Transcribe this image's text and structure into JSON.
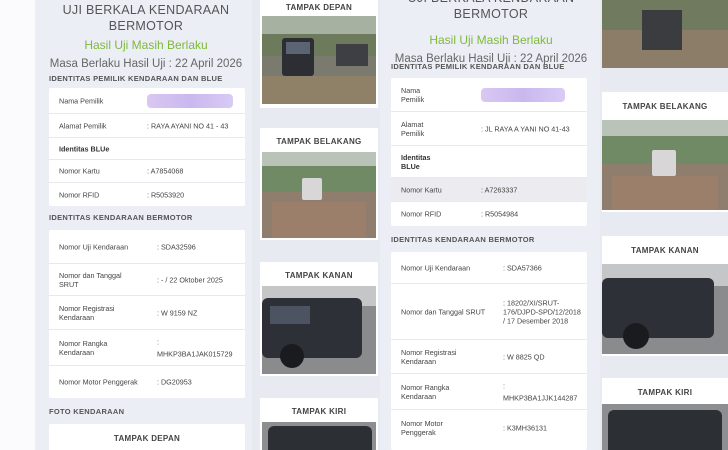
{
  "left": {
    "title_line1": "UJI BERKALA KENDARAAN",
    "title_line2": "BERMOTOR",
    "status": "Hasil Uji Masih Berlaku",
    "validity": "Masa Berlaku Hasil Uji : 22 April 2026",
    "owner_section": "IDENTITAS PEMILIK KENDARAAN DAN BLUe",
    "owner_rows": [
      {
        "label": "Nama Pemilik",
        "value": ""
      },
      {
        "label": "Alamat Pemilik",
        "value": ": RAYA AYANI NO 41 - 43"
      },
      {
        "label": "Identitas BLUe",
        "value": ""
      },
      {
        "label": "Nomor Kartu",
        "value": ": A7854068"
      },
      {
        "label": "Nomor RFID",
        "value": ": R5053920"
      }
    ],
    "vehicle_section": "IDENTITAS KENDARAAN BERMOTOR",
    "vehicle_rows": [
      {
        "label": "Nomor Uji Kendaraan",
        "value": ": SDA32596"
      },
      {
        "label": "Nomor dan Tanggal SRUT",
        "value": ": - / 22 Oktober 2025"
      },
      {
        "label": "Nomor Registrasi Kendaraan",
        "value": ": W 9159 NZ"
      },
      {
        "label": "Nomor Rangka Kendaraan",
        "value": ":",
        "value2": "MHKP3BA1JAK015729"
      },
      {
        "label": "Nomor Motor Penggerak",
        "value": ": DG20953"
      }
    ],
    "photo_section": "FOTO KENDARAAN",
    "photo_caption": "TAMPAK DEPAN"
  },
  "left_photos": [
    "TAMPAK DEPAN",
    "TAMPAK BELAKANG",
    "TAMPAK KANAN",
    "TAMPAK KIRI"
  ],
  "right": {
    "title_line1": "UJI BERKALA KENDARAAN BERMOTOR",
    "status": "Hasil Uji Masih Berlaku",
    "validity": "Masa Berlaku Hasil Uji : 22 April 2026",
    "owner_section": "IDENTITAS PEMILIK KENDARAAN DAN BLUe",
    "owner_rows": [
      {
        "label": "Nama Pemilik",
        "value": ""
      },
      {
        "label": "Alamat Pemilik",
        "value": ": JL RAYA A YANI NO 41-43"
      },
      {
        "label": "Identitas BLUe",
        "value": ""
      },
      {
        "label": "Nomor Kartu",
        "value": ": A7263337"
      },
      {
        "label": "Nomor RFID",
        "value": ": R5054984"
      }
    ],
    "vehicle_section": "IDENTITAS KENDARAAN BERMOTOR",
    "vehicle_rows": [
      {
        "label": "Nomor Uji Kendaraan",
        "value": ": SDA57366"
      },
      {
        "label": "Nomor dan Tanggal SRUT",
        "value": ": 18202/XI/SRUT-176/DJPD-SPD/12/2018 / 17 Desember 2018"
      },
      {
        "label": "Nomor Registrasi Kendaraan",
        "value": ": W 8825 QD"
      },
      {
        "label": "Nomor Rangka Kendaraan",
        "value": ":",
        "value2": "MHKP3BA1JJK144287"
      },
      {
        "label": "Nomor Motor Penggerak",
        "value": ": K3MH36131"
      }
    ]
  },
  "right_photos": [
    "TAMPAK BELAKANG",
    "TAMPAK KANAN",
    "TAMPAK KIRI"
  ]
}
